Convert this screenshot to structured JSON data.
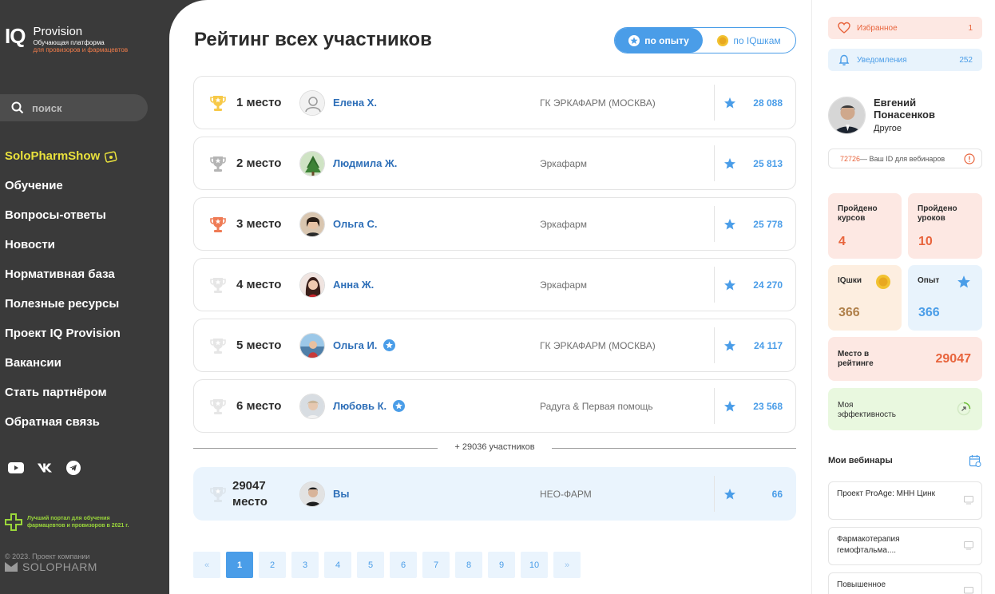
{
  "sidebar": {
    "logo": {
      "mark": "IQ",
      "name": "Provision",
      "sub1": "Обучающая платформа",
      "sub2": "для провизоров и фармацевтов"
    },
    "search": {
      "placeholder": "поиск"
    },
    "nav": [
      {
        "label": "SoloPharmShow",
        "highlight": true
      },
      {
        "label": "Обучение"
      },
      {
        "label": "Вопросы-ответы"
      },
      {
        "label": "Новости"
      },
      {
        "label": "Нормативная база"
      },
      {
        "label": "Полезные ресурсы"
      },
      {
        "label": "Проект IQ Provision"
      },
      {
        "label": "Вакансии"
      },
      {
        "label": "Стать партнёром"
      },
      {
        "label": "Обратная связь"
      }
    ],
    "socials": [
      "youtube-icon",
      "vk-icon",
      "telegram-icon"
    ],
    "award": "Лучший портал для обучения фармацевтов и провизоров в 2021 г.",
    "copyright": "© 2023. Проект компании",
    "company": "SOLOPHARM"
  },
  "main": {
    "title": "Рейтинг всех участников",
    "toggle": {
      "active": "по опыту",
      "inactive": "по IQшкам"
    },
    "rows": [
      {
        "place": "1 место",
        "name": "Елена Х.",
        "company": "ГК ЭРКАФАРМ (МОСКВА)",
        "score": "28 088",
        "cup": "gold",
        "verified": false
      },
      {
        "place": "2 место",
        "name": "Людмила Ж.",
        "company": "Эркафарм",
        "score": "25 813",
        "cup": "silver",
        "verified": false
      },
      {
        "place": "3 место",
        "name": "Ольга С.",
        "company": "Эркафарм",
        "score": "25 778",
        "cup": "bronze",
        "verified": false
      },
      {
        "place": "4 место",
        "name": "Анна Ж.",
        "company": "Эркафарм",
        "score": "24 270",
        "cup": "none",
        "verified": false
      },
      {
        "place": "5 место",
        "name": "Ольга И.",
        "company": "ГК ЭРКАФАРМ (МОСКВА)",
        "score": "24 117",
        "cup": "none",
        "verified": true
      },
      {
        "place": "6 место",
        "name": "Любовь К.",
        "company": "Радуга & Первая помощь",
        "score": "23 568",
        "cup": "none",
        "verified": true
      }
    ],
    "more": "+ 29036 участников",
    "me": {
      "place_line1": "29047",
      "place_line2": "место",
      "name": "Вы",
      "company": "НЕО-ФАРМ",
      "score": "66"
    },
    "pager": [
      "«",
      "1",
      "2",
      "3",
      "4",
      "5",
      "6",
      "7",
      "8",
      "9",
      "10",
      "»"
    ],
    "pager_active": "1"
  },
  "right": {
    "favorites": {
      "label": "Избранное",
      "count": "1"
    },
    "notifications": {
      "label": "Уведомления",
      "count": "252"
    },
    "profile": {
      "name": "Евгений Понасенков",
      "role": "Другое"
    },
    "webinar_id": {
      "id": "72726",
      "label": " — Ваш ID для вебинаров"
    },
    "stats": {
      "courses": {
        "label": "Пройдено курсов",
        "value": "4"
      },
      "lessons": {
        "label": "Пройдено уроков",
        "value": "10"
      },
      "iq": {
        "label": "IQшки",
        "value": "366"
      },
      "exp": {
        "label": "Опыт",
        "value": "366"
      },
      "rank": {
        "label": "Место в рейтинге",
        "value": "29047"
      },
      "efficiency": {
        "label": "Моя эффективность"
      }
    },
    "webinars_title": "Мои вебинары",
    "webinars": [
      "Проект ProAge: МНН Цинк",
      "Фармакотерапия гемофтальма....",
      "Повышенное"
    ]
  },
  "colors": {
    "accent": "#4a9de8",
    "orange": "#e8643c",
    "highlight": "#e9e13c"
  }
}
